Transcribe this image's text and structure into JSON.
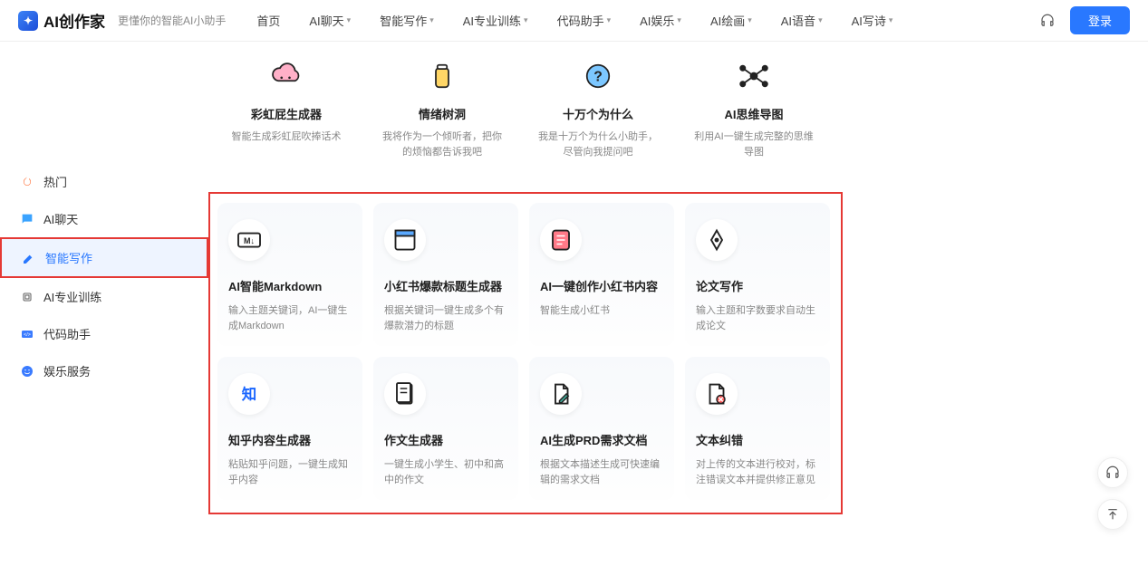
{
  "header": {
    "logo_text": "AI创作家",
    "tagline": "更懂你的智能AI小助手",
    "nav": [
      "首页",
      "AI聊天",
      "智能写作",
      "AI专业训练",
      "代码助手",
      "AI娱乐",
      "AI绘画",
      "AI语音",
      "AI写诗"
    ],
    "nav_has_dropdown": [
      false,
      true,
      true,
      true,
      true,
      true,
      true,
      true,
      true
    ],
    "login": "登录"
  },
  "sidebar": {
    "items": [
      {
        "icon": "fire",
        "label": "热门"
      },
      {
        "icon": "chat",
        "label": "AI聊天"
      },
      {
        "icon": "edit",
        "label": "智能写作",
        "active": true
      },
      {
        "icon": "chip",
        "label": "AI专业训练"
      },
      {
        "icon": "code",
        "label": "代码助手"
      },
      {
        "icon": "smile",
        "label": "娱乐服务"
      }
    ]
  },
  "top_cards": [
    {
      "icon": "cloud",
      "title": "彩虹屁生成器",
      "desc": "智能生成彩虹屁吹捧话术"
    },
    {
      "icon": "jar",
      "title": "情绪树洞",
      "desc": "我将作为一个倾听者，把你的烦恼都告诉我吧"
    },
    {
      "icon": "question",
      "title": "十万个为什么",
      "desc": "我是十万个为什么小助手，尽管向我提问吧"
    },
    {
      "icon": "mindmap",
      "title": "AI思维导图",
      "desc": "利用AI一键生成完整的思维导图"
    }
  ],
  "main_cards": [
    {
      "icon": "markdown",
      "title": "AI智能Markdown",
      "desc": "输入主题关键词，AI一键生成Markdown"
    },
    {
      "icon": "window",
      "title": "小红书爆款标题生成器",
      "desc": "根据关键词一键生成多个有爆款潜力的标题"
    },
    {
      "icon": "note",
      "title": "AI一键创作小红书内容",
      "desc": "智能生成小红书"
    },
    {
      "icon": "pen",
      "title": "论文写作",
      "desc": "输入主题和字数要求自动生成论文"
    },
    {
      "icon": "zhi",
      "title": "知乎内容生成器",
      "desc": "粘贴知乎问题，一键生成知乎内容"
    },
    {
      "icon": "doc",
      "title": "作文生成器",
      "desc": "一键生成小学生、初中和高中的作文"
    },
    {
      "icon": "docedit",
      "title": "AI生成PRD需求文档",
      "desc": "根据文本描述生成可快速编辑的需求文档"
    },
    {
      "icon": "docerror",
      "title": "文本纠错",
      "desc": "对上传的文本进行校对，标注错误文本并提供修正意见"
    }
  ]
}
